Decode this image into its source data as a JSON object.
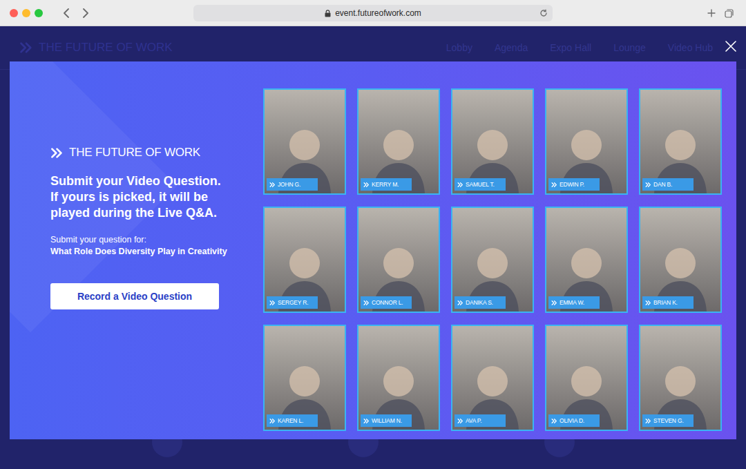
{
  "browser": {
    "url": "event.futureofwork.com"
  },
  "site": {
    "logo": "THE FUTURE OF WORK",
    "nav": [
      "Lobby",
      "Agenda",
      "Expo Hall",
      "Lounge",
      "Video Hub"
    ]
  },
  "modal": {
    "logo": "THE FUTURE OF WORK",
    "heading": [
      "Submit your Video Question.",
      "If yours is picked, it will be",
      "played during the Live Q&A."
    ],
    "subheading": "Submit your question for:",
    "session": "What Role Does Diversity Play in Creativity",
    "button": "Record a Video Question",
    "participants": [
      {
        "name": "JOHN G."
      },
      {
        "name": "KERRY M."
      },
      {
        "name": "SAMUEL T."
      },
      {
        "name": "EDWIN P."
      },
      {
        "name": "DAN B."
      },
      {
        "name": "SERGEY R."
      },
      {
        "name": "CONNOR L."
      },
      {
        "name": "DANIKA S."
      },
      {
        "name": "EMMA W."
      },
      {
        "name": "BRIAN K."
      },
      {
        "name": "KAREN L."
      },
      {
        "name": "WILLIAM N."
      },
      {
        "name": "AVA P."
      },
      {
        "name": "OLIVIA D."
      },
      {
        "name": "STEVEN G."
      }
    ]
  }
}
